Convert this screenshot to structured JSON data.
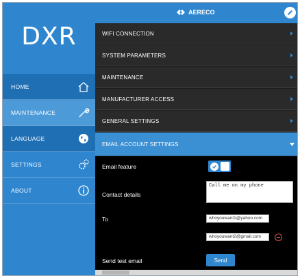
{
  "app": {
    "brand": "DXR",
    "logo_text": "AERECO"
  },
  "colors": {
    "accent": "#2f86cf",
    "section_bg": "#2a2a2a",
    "content_bg": "#000000",
    "remove": "#e05353"
  },
  "sidebar": {
    "items": [
      {
        "label": "HOME",
        "icon": "home-icon"
      },
      {
        "label": "MAINTENANCE",
        "icon": "wrench-icon"
      },
      {
        "label": "LANGUAGE",
        "icon": "globe-icon"
      },
      {
        "label": "SETTINGS",
        "icon": "gears-icon"
      },
      {
        "label": "ABOUT",
        "icon": "info-icon"
      }
    ]
  },
  "sections": [
    {
      "label": "WIFI CONNECTION"
    },
    {
      "label": "SYSTEM PARAMETERS"
    },
    {
      "label": "MAINTENANCE"
    },
    {
      "label": "MANUFACTURER ACCESS"
    },
    {
      "label": "GENERAL SETTINGS"
    },
    {
      "label": "EMAIL ACCOUNT SETTINGS"
    }
  ],
  "email": {
    "feature_label": "Email feature",
    "feature_enabled": true,
    "contact_label": "Contact details",
    "contact_value": "Call me on my phone",
    "to_label": "To",
    "to_1": "whoyouwant1@yahoo.com",
    "to_2": "whoyouwant2@gmail.com",
    "test_label": "Send test email",
    "send_label": "Send"
  }
}
